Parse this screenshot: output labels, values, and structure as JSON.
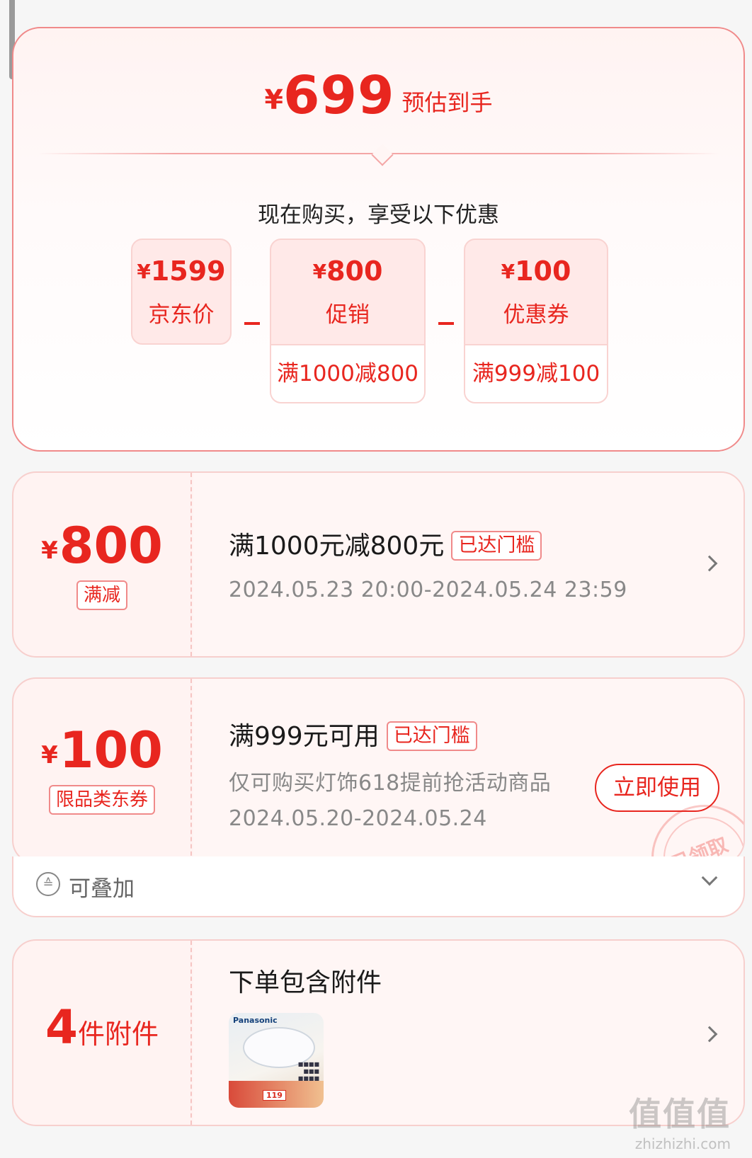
{
  "summary": {
    "currency": "¥",
    "estimate_price": "699",
    "estimate_label": "预估到手",
    "buy_now_text": "现在购买，享受以下优惠",
    "items": [
      {
        "amount": "1599",
        "name": "京东价",
        "rule": ""
      },
      {
        "amount": "800",
        "name": "促销",
        "rule": "满1000减800"
      },
      {
        "amount": "100",
        "name": "优惠券",
        "rule": "满999减100"
      }
    ]
  },
  "promo": {
    "currency": "¥",
    "amount": "800",
    "tag": "满减",
    "title": "满1000元减800元",
    "badge": "已达门槛",
    "period": "2024.05.23 20:00-2024.05.24 23:59"
  },
  "coupon": {
    "currency": "¥",
    "amount": "100",
    "tag": "限品类东券",
    "title": "满999元可用",
    "badge": "已达门槛",
    "scope": "仅可购买灯饰618提前抢活动商品",
    "period": "2024.05.20-2024.05.24",
    "use_button": "立即使用",
    "stamp": "已领取",
    "stack_label": "可叠加"
  },
  "accessory": {
    "count": "4",
    "unit": "件附件",
    "title": "下单包含附件",
    "thumb_brand": "Panasonic",
    "thumb_price": "119"
  },
  "watermark": {
    "logo": "值值值",
    "url": "zhizhizhi.com"
  },
  "colors": {
    "accent": "#e8261f",
    "card_bg": "#fff3f2",
    "border": "#f7cfcd"
  }
}
